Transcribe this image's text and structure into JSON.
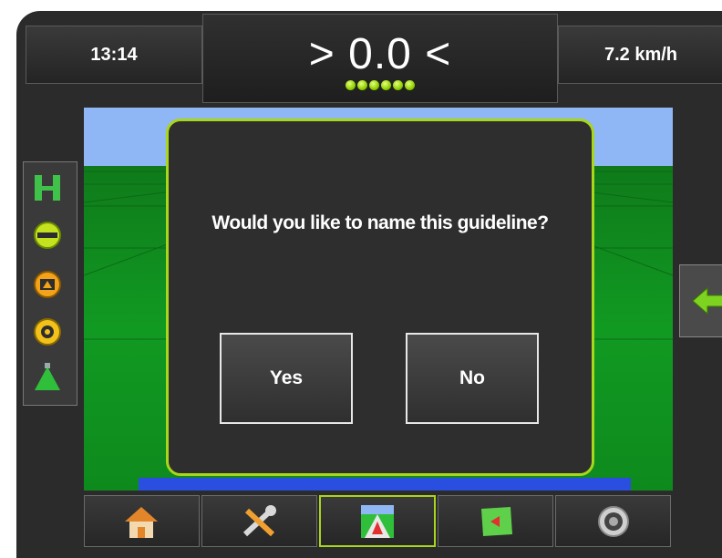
{
  "status": {
    "time": "13:14",
    "cross_track": "> 0.0 <",
    "speed": "7.2 km/h",
    "guidance_leds": 6
  },
  "dialog": {
    "message": "Would you like to name this guideline?",
    "yes_label": "Yes",
    "no_label": "No"
  },
  "left_toolbar": {
    "items": [
      "steering-icon",
      "boom-icon",
      "work-light-icon",
      "pressure-sensor-icon",
      "spray-pattern-icon"
    ]
  },
  "bottom_nav": {
    "items": [
      "home-icon",
      "tools-icon",
      "guidance-icon",
      "map-icon",
      "camera-icon"
    ],
    "active": "guidance-icon"
  },
  "colors": {
    "accent": "#a8d61a",
    "sky": "#8fb6f5",
    "field": "#119a22",
    "background": "#2b2b2b"
  }
}
